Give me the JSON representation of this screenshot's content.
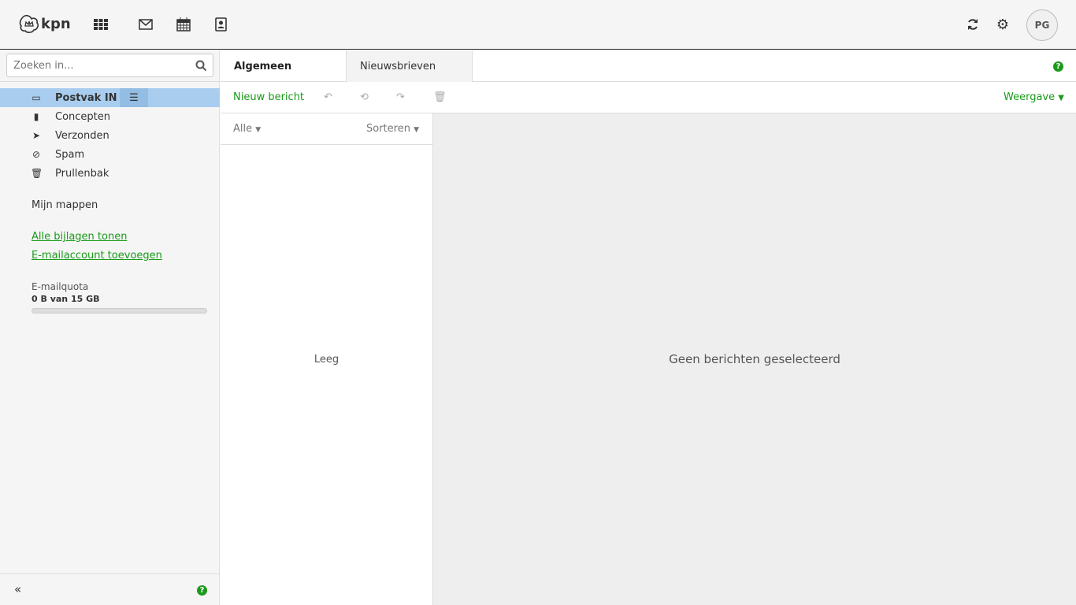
{
  "header": {
    "logo": "kpn",
    "avatar": "PG"
  },
  "search": {
    "placeholder": "Zoeken in..."
  },
  "folders": [
    {
      "label": "Postvak IN"
    },
    {
      "label": "Concepten"
    },
    {
      "label": "Verzonden"
    },
    {
      "label": "Spam"
    },
    {
      "label": "Prullenbak"
    }
  ],
  "sidebar": {
    "my_folders": "Mijn mappen",
    "link_attachments": "Alle bijlagen tonen",
    "link_add_account": "E-mailaccount toevoegen",
    "quota_label": "E-mailquota",
    "quota_value": "0 B van 15 GB",
    "quota_fraction": 0
  },
  "tabs": [
    {
      "label": "Algemeen"
    },
    {
      "label": "Nieuwsbrieven"
    }
  ],
  "toolbar": {
    "new": "Nieuw bericht",
    "view": "Weergave"
  },
  "list": {
    "filter": "Alle",
    "sort": "Sorteren",
    "empty": "Leeg"
  },
  "detail": {
    "empty": "Geen berichten geselecteerd"
  },
  "colors": {
    "accent": "#1a9a1a",
    "selected": "#a8cdee"
  }
}
